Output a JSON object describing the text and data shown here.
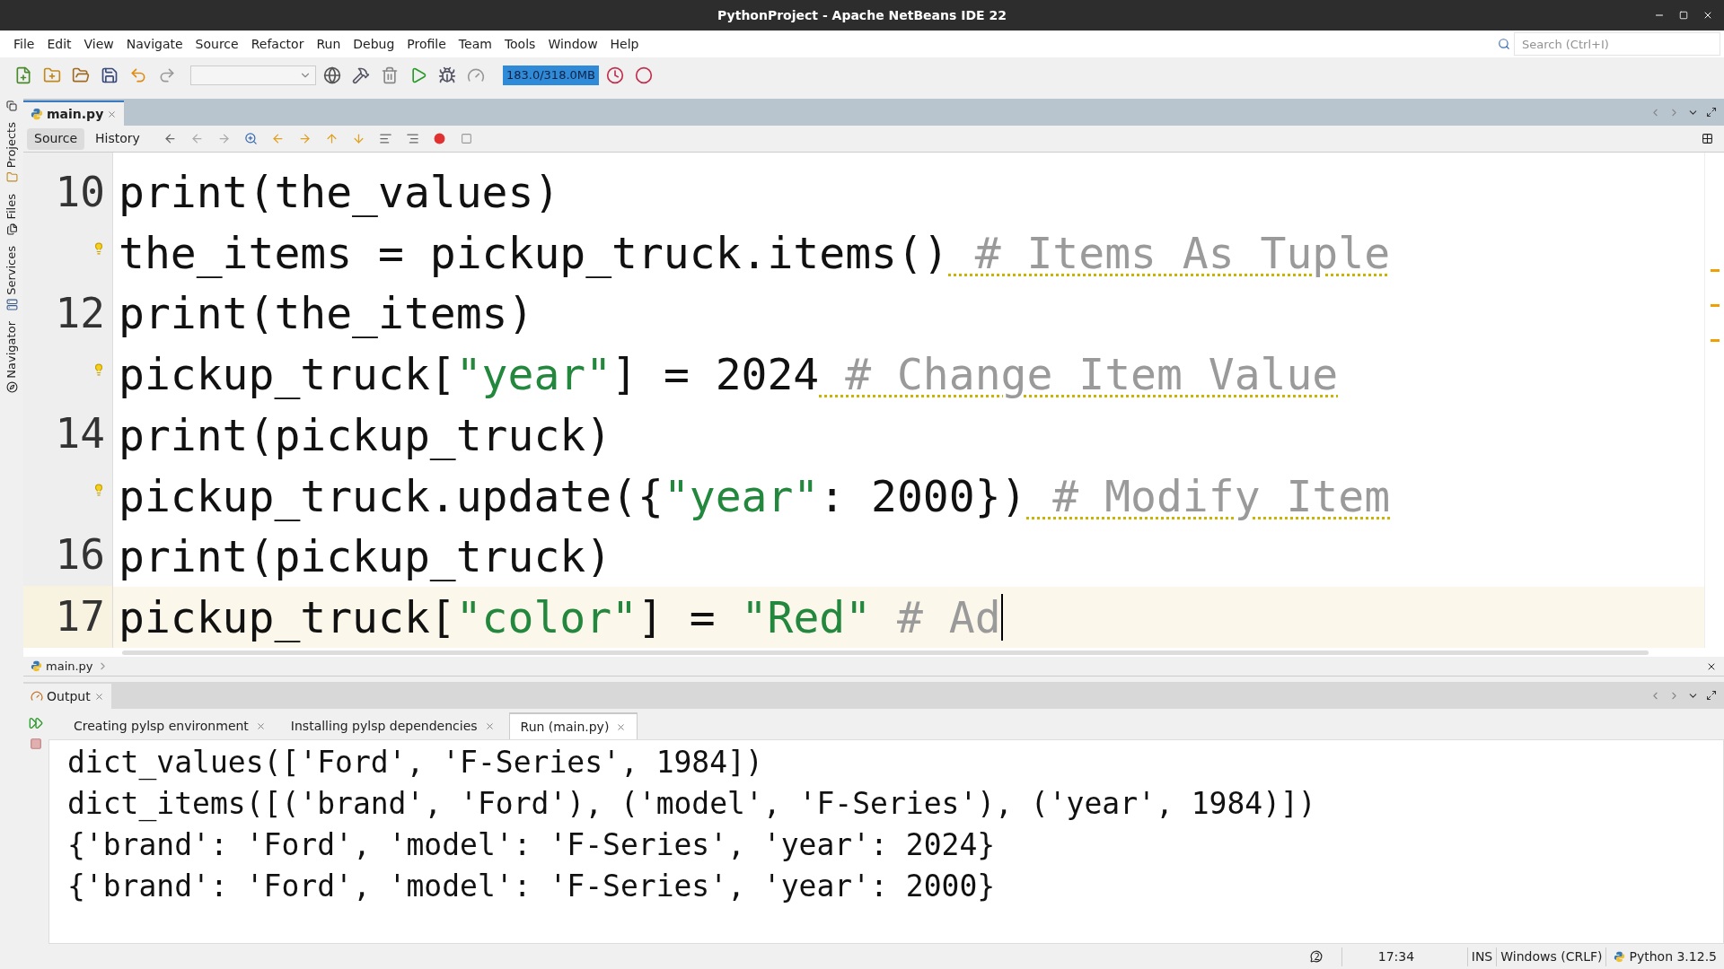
{
  "window": {
    "title": "PythonProject - Apache NetBeans IDE 22"
  },
  "menu": [
    "File",
    "Edit",
    "View",
    "Navigate",
    "Source",
    "Refactor",
    "Run",
    "Debug",
    "Profile",
    "Team",
    "Tools",
    "Window",
    "Help"
  ],
  "search": {
    "placeholder": "Search (Ctrl+I)"
  },
  "toolbar": {
    "memory": "183.0/318.0MB"
  },
  "side_tabs": [
    {
      "label": "Projects"
    },
    {
      "label": "Files"
    },
    {
      "label": "Services"
    },
    {
      "label": "Navigator"
    }
  ],
  "editor": {
    "tabs": [
      {
        "label": "main.py",
        "selected": true
      }
    ],
    "views": [
      {
        "label": "Source",
        "selected": true
      },
      {
        "label": "History",
        "selected": false
      }
    ],
    "lines": [
      {
        "number": "10",
        "hint": false,
        "current": false,
        "tokens": [
          {
            "kind": "code",
            "text": "print(the_values)"
          }
        ]
      },
      {
        "hint": true,
        "current": false,
        "tokens": [
          {
            "kind": "code",
            "text": "the_items = pickup_truck.items()"
          },
          {
            "kind": "comment",
            "underlined": true,
            "text": " # Items As Tuple"
          }
        ]
      },
      {
        "number": "12",
        "hint": false,
        "current": false,
        "tokens": [
          {
            "kind": "code",
            "text": "print(the_items)"
          }
        ]
      },
      {
        "hint": true,
        "current": false,
        "tokens": [
          {
            "kind": "code",
            "text": "pickup_truck["
          },
          {
            "kind": "string",
            "text": "\"year\""
          },
          {
            "kind": "code",
            "text": "] = 2024"
          },
          {
            "kind": "comment",
            "underlined": true,
            "text": " # Change Item Value"
          }
        ]
      },
      {
        "number": "14",
        "hint": false,
        "current": false,
        "tokens": [
          {
            "kind": "code",
            "text": "print(pickup_truck)"
          }
        ]
      },
      {
        "hint": true,
        "current": false,
        "tokens": [
          {
            "kind": "code",
            "text": "pickup_truck.update({"
          },
          {
            "kind": "string",
            "text": "\"year\""
          },
          {
            "kind": "code",
            "text": ": 2000})"
          },
          {
            "kind": "comment",
            "underlined": true,
            "text": " # Modify Item"
          }
        ]
      },
      {
        "number": "16",
        "hint": false,
        "current": false,
        "tokens": [
          {
            "kind": "code",
            "text": "print(pickup_truck)"
          }
        ]
      },
      {
        "number": "17",
        "hint": false,
        "current": true,
        "tokens": [
          {
            "kind": "code",
            "text": "pickup_truck["
          },
          {
            "kind": "string",
            "text": "\"color\""
          },
          {
            "kind": "code",
            "text": "] = "
          },
          {
            "kind": "string",
            "text": "\"Red\""
          },
          {
            "kind": "comment",
            "underlined": false,
            "text": " # Ad"
          }
        ]
      }
    ],
    "breadcrumb": "main.py"
  },
  "output": {
    "title": "Output",
    "tabs": [
      {
        "label": "Creating pylsp environment",
        "selected": false
      },
      {
        "label": "Installing pylsp dependencies",
        "selected": false
      },
      {
        "label": "Run (main.py)",
        "selected": true
      }
    ],
    "lines": [
      "dict_values(['Ford', 'F-Series', 1984])",
      "dict_items([('brand', 'Ford'), ('model', 'F-Series'), ('year', 1984)])",
      "{'brand': 'Ford', 'model': 'F-Series', 'year': 2024}",
      "{'brand': 'Ford', 'model': 'F-Series', 'year': 2000}"
    ]
  },
  "status_bar": {
    "notifications": "2",
    "position": "17:34",
    "mode": "INS",
    "line_endings": "Windows (CRLF)",
    "platform": "Python 3.12.5"
  }
}
